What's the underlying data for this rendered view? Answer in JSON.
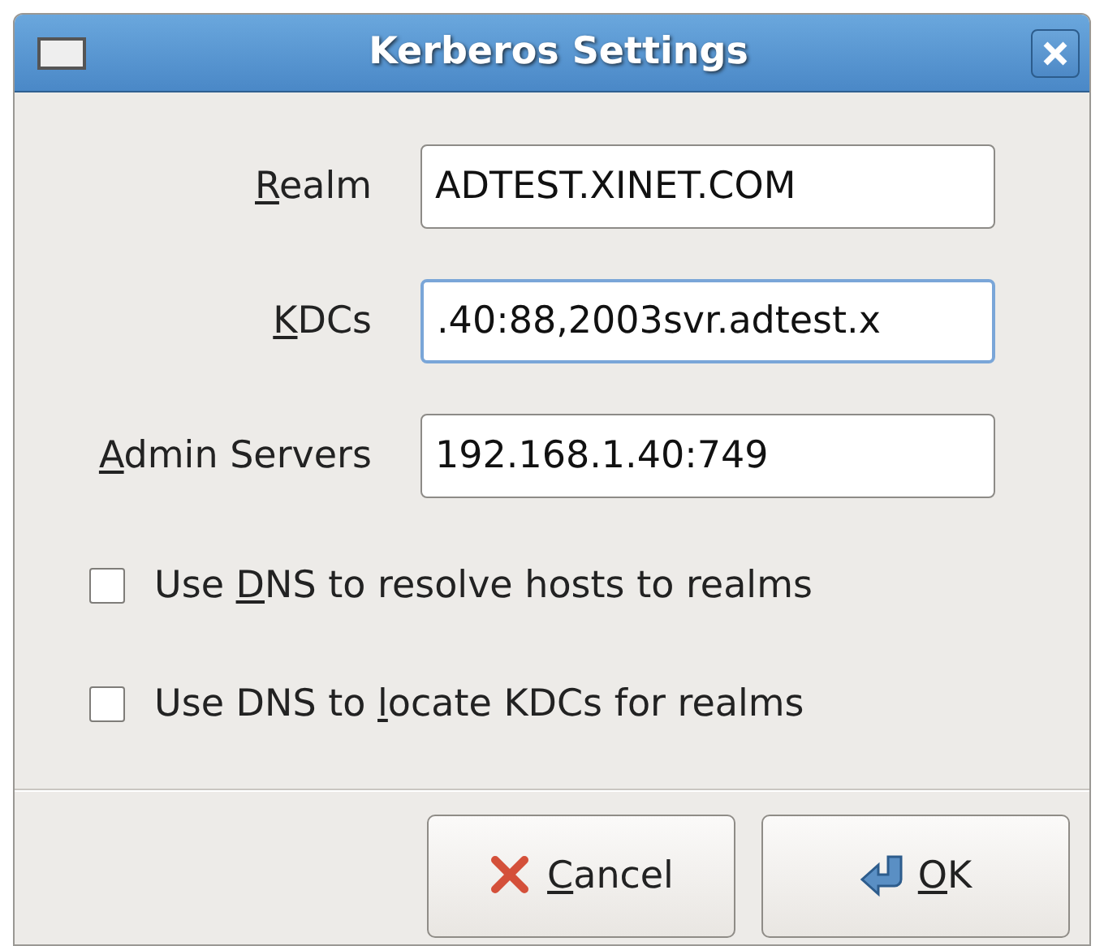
{
  "window": {
    "title": "Kerberos Settings"
  },
  "fields": [
    {
      "label": {
        "key": "R",
        "after": "ealm"
      },
      "value": "ADTEST.XINET.COM",
      "focused": false
    },
    {
      "label": {
        "key": "K",
        "after": "DCs"
      },
      "value": ".40:88,2003svr.adtest.x",
      "focused": true
    },
    {
      "label": {
        "key": "A",
        "after": "dmin Servers"
      },
      "value": "192.168.1.40:749",
      "focused": false
    }
  ],
  "checkboxes": [
    {
      "label": {
        "before": "Use ",
        "key": "D",
        "after": "NS to resolve hosts to realms"
      },
      "checked": false
    },
    {
      "label": {
        "before": "Use DNS to ",
        "key": "l",
        "after": "ocate KDCs for realms"
      },
      "checked": false
    }
  ],
  "buttons": [
    {
      "kind": "cancel",
      "label": {
        "key": "C",
        "after": "ancel"
      }
    },
    {
      "kind": "ok",
      "label": {
        "key": "O",
        "after": "K"
      }
    }
  ]
}
